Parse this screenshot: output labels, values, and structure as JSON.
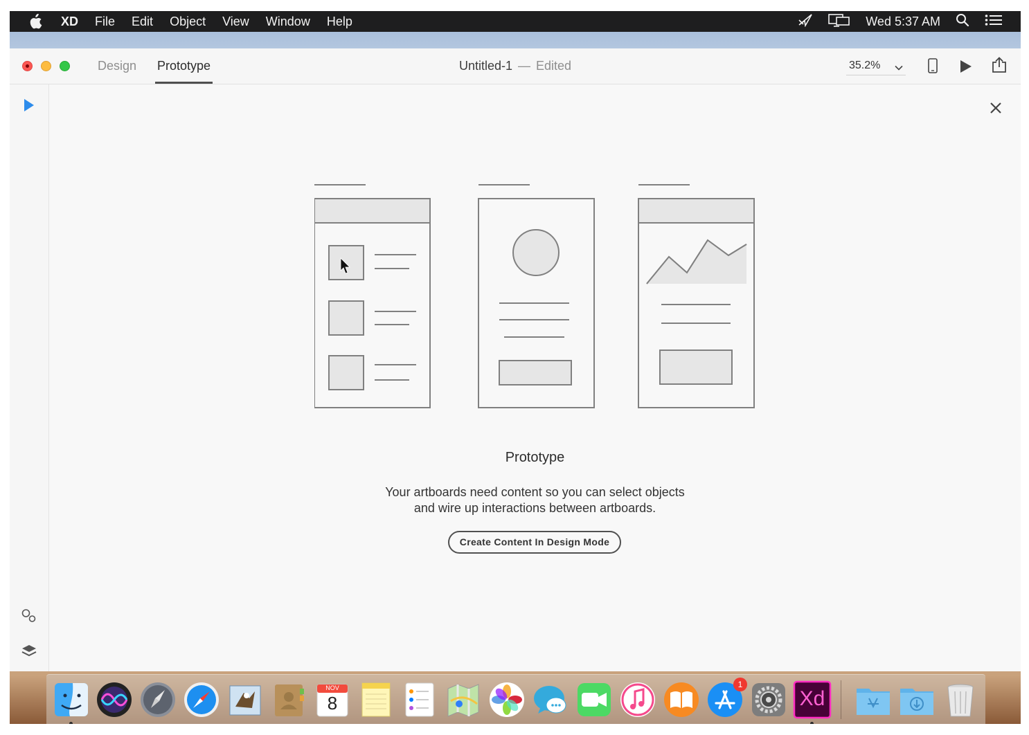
{
  "menubar": {
    "app_name": "XD",
    "menus": [
      "File",
      "Edit",
      "Object",
      "View",
      "Window",
      "Help"
    ],
    "clock": "Wed 5:37 AM",
    "icons": [
      "apple-icon",
      "airplay-cast-icon",
      "display-mirroring-icon",
      "spotlight-search-icon",
      "notification-center-icon"
    ]
  },
  "toolbar": {
    "tabs": {
      "design": "Design",
      "prototype": "Prototype"
    },
    "active_tab": "Prototype",
    "document_title": "Untitled-1",
    "separator": "—",
    "document_status": "Edited",
    "zoom": "35.2%",
    "icons": [
      "zoom-chevron-down-icon",
      "device-preview-icon",
      "play-preview-icon",
      "share-icon"
    ]
  },
  "rail": {
    "icons": [
      "select-arrow-icon",
      "assets-icon",
      "layers-icon"
    ]
  },
  "empty_state": {
    "title": "Prototype",
    "body_line1": "Your artboards need content so you can select objects",
    "body_line2": "and wire up interactions between artboards.",
    "button_label": "Create Content In Design Mode"
  },
  "dock": {
    "items": [
      {
        "name": "finder",
        "running": true
      },
      {
        "name": "siri",
        "running": false
      },
      {
        "name": "launchpad",
        "running": false
      },
      {
        "name": "safari",
        "running": false
      },
      {
        "name": "mail",
        "running": false
      },
      {
        "name": "contacts",
        "running": false
      },
      {
        "name": "calendar",
        "running": false,
        "month": "NOV",
        "day": "8"
      },
      {
        "name": "notes",
        "running": false
      },
      {
        "name": "reminders",
        "running": false
      },
      {
        "name": "maps",
        "running": false
      },
      {
        "name": "photos",
        "running": false
      },
      {
        "name": "messages",
        "running": false
      },
      {
        "name": "facetime",
        "running": false
      },
      {
        "name": "itunes",
        "running": false
      },
      {
        "name": "ibooks",
        "running": false
      },
      {
        "name": "app-store",
        "running": false,
        "badge": "1"
      },
      {
        "name": "system-preferences",
        "running": false
      },
      {
        "name": "adobe-xd",
        "running": true,
        "label": "Xd"
      },
      {
        "name": "applications-folder",
        "running": false
      },
      {
        "name": "downloads-folder",
        "running": false
      },
      {
        "name": "trash",
        "running": false
      }
    ]
  },
  "colors": {
    "menubar_bg": "#1e1e1f",
    "accent_blue": "#2d8ceb",
    "xd_magenta": "#ff2bc2",
    "xd_bg": "#470137",
    "wireframe_stroke": "#808080",
    "wireframe_fill": "#e6e6e6"
  }
}
